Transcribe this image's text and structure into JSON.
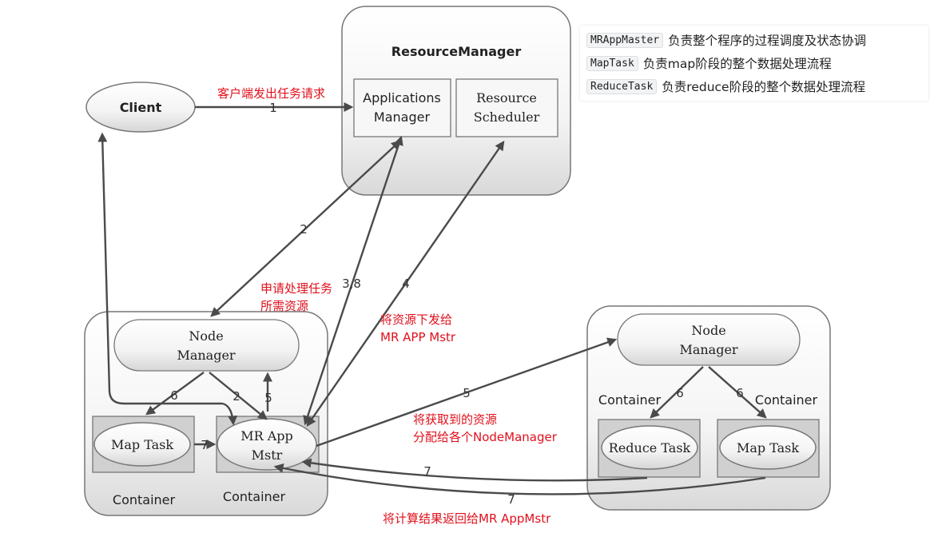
{
  "resource_manager": {
    "title": "ResourceManager",
    "applications_manager": [
      "Applications",
      "Manager"
    ],
    "resource_scheduler": [
      "Resource",
      "Scheduler"
    ]
  },
  "client": {
    "label": "Client"
  },
  "left_node": {
    "node_manager": [
      "Node",
      "Manager"
    ],
    "map_task": "Map Task",
    "mr_app_mstr": [
      "MR App",
      "Mstr"
    ],
    "container_left": "Container",
    "container_right": "Container"
  },
  "right_node": {
    "node_manager": [
      "Node",
      "Manager"
    ],
    "container_left": "Container",
    "container_right": "Container",
    "reduce_task": "Reduce Task",
    "map_task": "Map Task"
  },
  "arrow_numbers": {
    "n1": "1",
    "n2a": "2",
    "n38": "3,8",
    "n4": "4",
    "n5a": "5",
    "n5b": "5",
    "n6a": "6",
    "n2b": "2",
    "n6b": "6",
    "n6c": "6",
    "n7a": "7",
    "n7b": "7",
    "n7c": "7"
  },
  "annotations": {
    "client_request": "客户端发出任务请求",
    "apply_resources": [
      "申请处理任务",
      "所需资源"
    ],
    "deliver_resources": [
      "将资源下发给",
      "MR APP Mstr"
    ],
    "distribute_resources": [
      "将获取到的资源",
      "分配给各个NodeManager"
    ],
    "return_results": "将计算结果返回给MR AppMstr"
  },
  "legend": [
    {
      "code": "MRAppMaster",
      "desc": "负责整个程序的过程调度及状态协调"
    },
    {
      "code": "MapTask",
      "desc": "负责map阶段的整个数据处理流程"
    },
    {
      "code": "ReduceTask",
      "desc": "负责reduce阶段的整个数据处理流程"
    }
  ],
  "colors": {
    "annotation": "#e0101c",
    "arrow": "#4a4a4a"
  }
}
